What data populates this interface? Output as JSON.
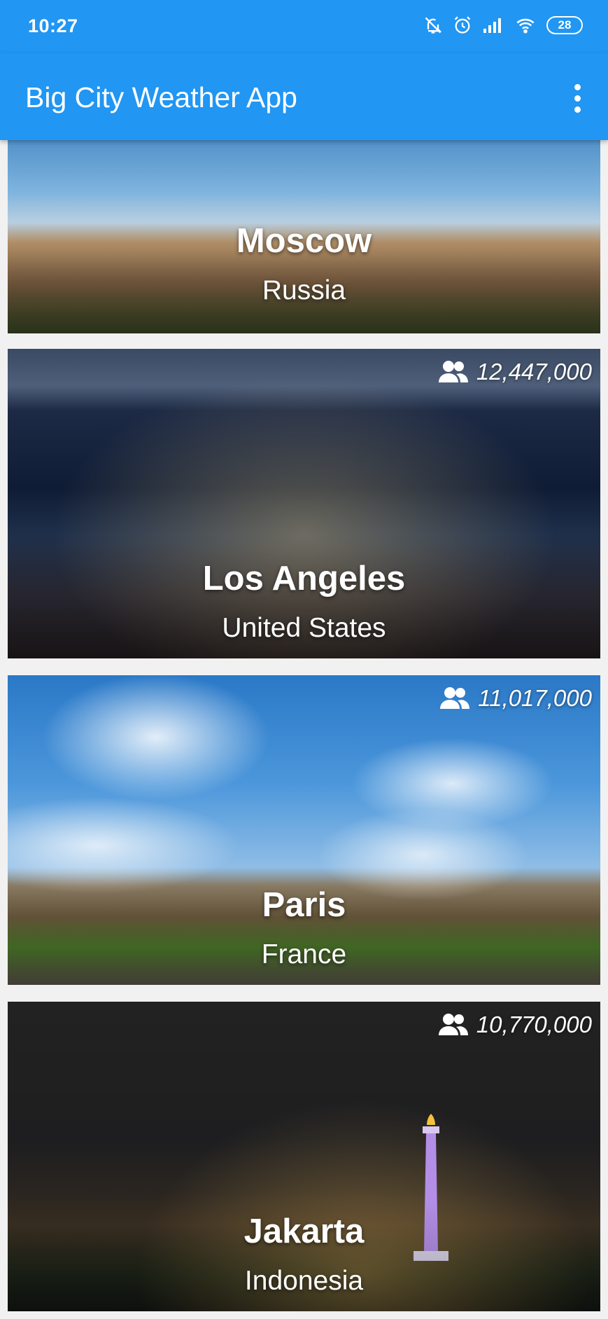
{
  "status_bar": {
    "time": "10:27",
    "icons": [
      "bell-off-icon",
      "alarm-icon",
      "signal-icon",
      "wifi-icon",
      "battery-icon"
    ],
    "battery_level": "28"
  },
  "app_bar": {
    "title": "Big City Weather App",
    "menu_icon": "more-vert-icon",
    "background_color": "#2196f3"
  },
  "cities": [
    {
      "city": "Moscow",
      "country": "Russia"
    },
    {
      "city": "Los Angeles",
      "country": "United States",
      "population": "12,447,000",
      "icon": "people-icon"
    },
    {
      "city": "Paris",
      "country": "France",
      "population": "11,017,000",
      "icon": "people-icon"
    },
    {
      "city": "Jakarta",
      "country": "Indonesia",
      "population": "10,770,000",
      "icon": "people-icon"
    }
  ]
}
